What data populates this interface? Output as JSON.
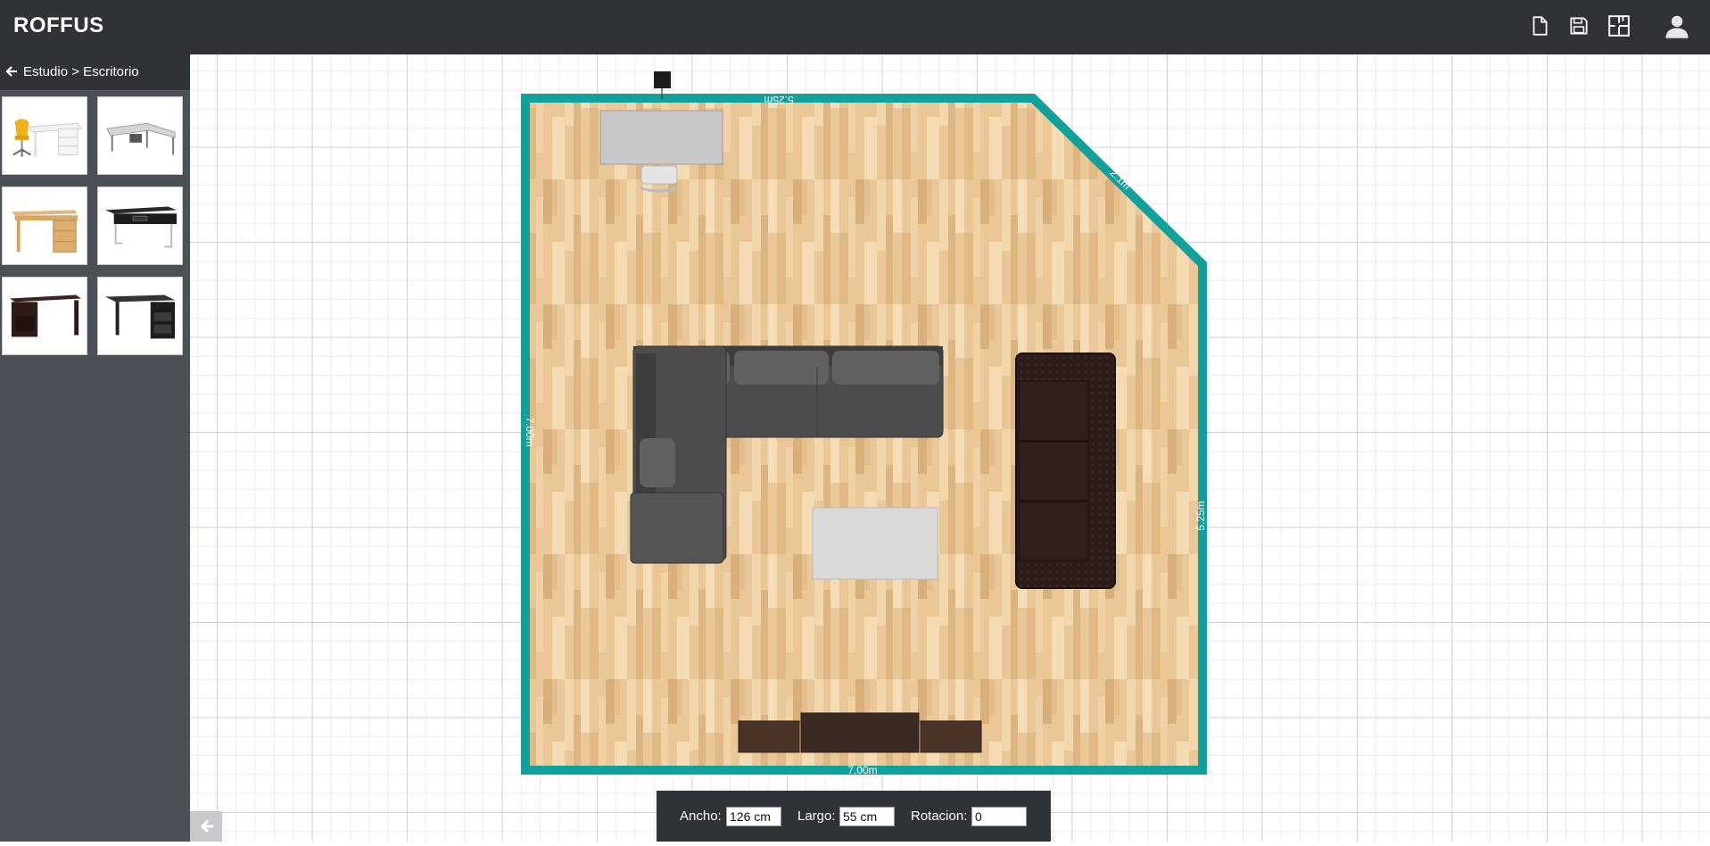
{
  "app": {
    "title": "ROFFUS"
  },
  "toolbar": {
    "icons": [
      "new-file-icon",
      "save-icon",
      "floorplan-icon",
      "user-icon"
    ]
  },
  "sidebar": {
    "breadcrumb": "Estudio > Escritorio",
    "items": [
      {
        "name": "desk-with-yellow-chair"
      },
      {
        "name": "l-shaped-glass-desk"
      },
      {
        "name": "wooden-desk-with-drawers"
      },
      {
        "name": "black-desk-chrome-legs"
      },
      {
        "name": "dark-wood-desk"
      },
      {
        "name": "black-desk-with-drawers"
      }
    ]
  },
  "plan": {
    "wall_color": "#10a19d",
    "dimensions": {
      "top": "5.25m",
      "diagonal": "2.1m",
      "left": "7.00m",
      "right": "5.25m",
      "bottom": "7.00m"
    },
    "objects": [
      "desk",
      "l-sofa",
      "coffee-table",
      "dark-sofa",
      "tv-stand"
    ]
  },
  "properties": {
    "ancho_label": "Ancho:",
    "ancho_value": "126 cm",
    "largo_label": "Largo:",
    "largo_value": "55 cm",
    "rotacion_label": "Rotacion:",
    "rotacion_value": "0"
  }
}
